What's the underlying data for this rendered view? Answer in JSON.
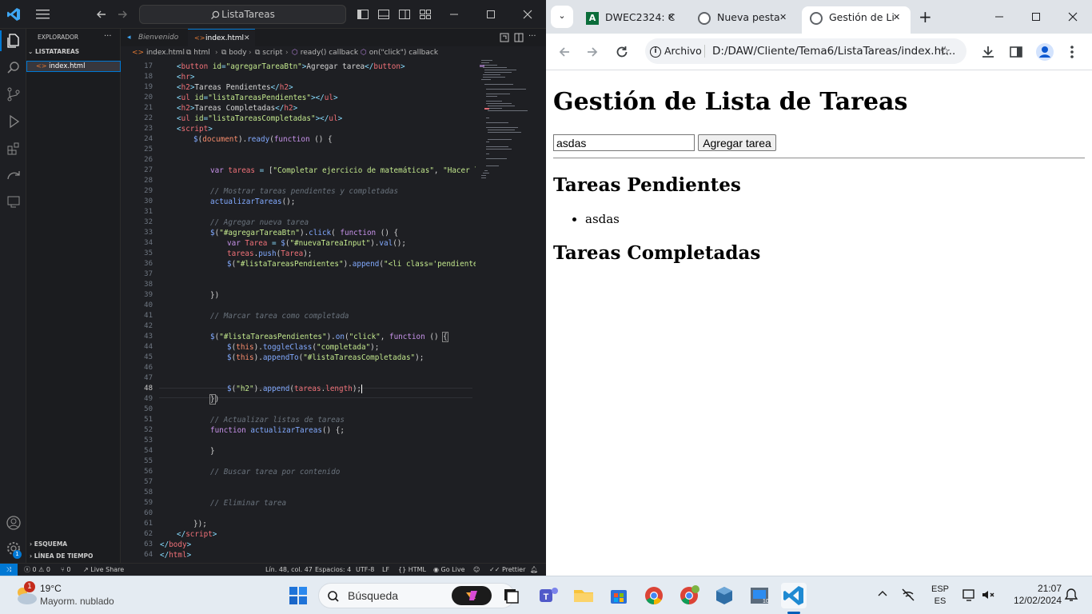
{
  "vscode": {
    "search_text": "ListaTareas",
    "sidebar": {
      "title": "EXPLORADOR",
      "folder": "LISTATAREAS",
      "file": "index.html",
      "outline": "ESQUEMA",
      "timeline": "LÍNEA DE TIEMPO"
    },
    "tabs": [
      {
        "label": "Bienvenido"
      },
      {
        "label": "index.html"
      }
    ],
    "breadcrumbs": [
      "index.html",
      "html",
      "body",
      "script",
      "ready() callback",
      "on(\"click\") callback"
    ],
    "line_numbers": [
      "17",
      "18",
      "19",
      "20",
      "21",
      "22",
      "23",
      "24",
      "25",
      "26",
      "27",
      "28",
      "29",
      "30",
      "31",
      "32",
      "33",
      "34",
      "35",
      "36",
      "37",
      "38",
      "39",
      "40",
      "41",
      "42",
      "43",
      "44",
      "45",
      "46",
      "47",
      "48",
      "49",
      "50",
      "51",
      "52",
      "53",
      "54",
      "55",
      "56",
      "57",
      "58",
      "59",
      "60",
      "61",
      "62",
      "63",
      "64"
    ],
    "status": {
      "errors": "0",
      "warnings": "0",
      "ports": "0",
      "live_share": "Live Share",
      "position": "Lín. 48, col. 47",
      "spaces": "Espacios: 4",
      "encoding": "UTF-8",
      "eol": "LF",
      "language": "HTML",
      "go_live": "Go Live",
      "prettier": "Prettier",
      "account_badge": "1"
    }
  },
  "chrome": {
    "tabs": [
      {
        "label": "DWEC2324: C"
      },
      {
        "label": "Nueva pesta"
      },
      {
        "label": "Gestión de Li"
      }
    ],
    "omnibox": {
      "chip": "Archivo",
      "url": "D:/DAW/Cliente/Tema6/ListaTareas/index.ht..."
    },
    "page": {
      "heading": "Gestión de Lista de Tareas",
      "input_value": "asdas",
      "button_label": "Agregar tarea",
      "pending_heading": "Tareas Pendientes",
      "pending_items": [
        "asdas"
      ],
      "completed_heading": "Tareas Completadas"
    }
  },
  "taskbar": {
    "weather_temp": "19°C",
    "weather_desc": "Mayorm. nublado",
    "weather_badge": "1",
    "search_placeholder": "Búsqueda",
    "lang": "ESP",
    "lang_sub": "ES",
    "time": "21:07",
    "date": "12/02/2024"
  }
}
